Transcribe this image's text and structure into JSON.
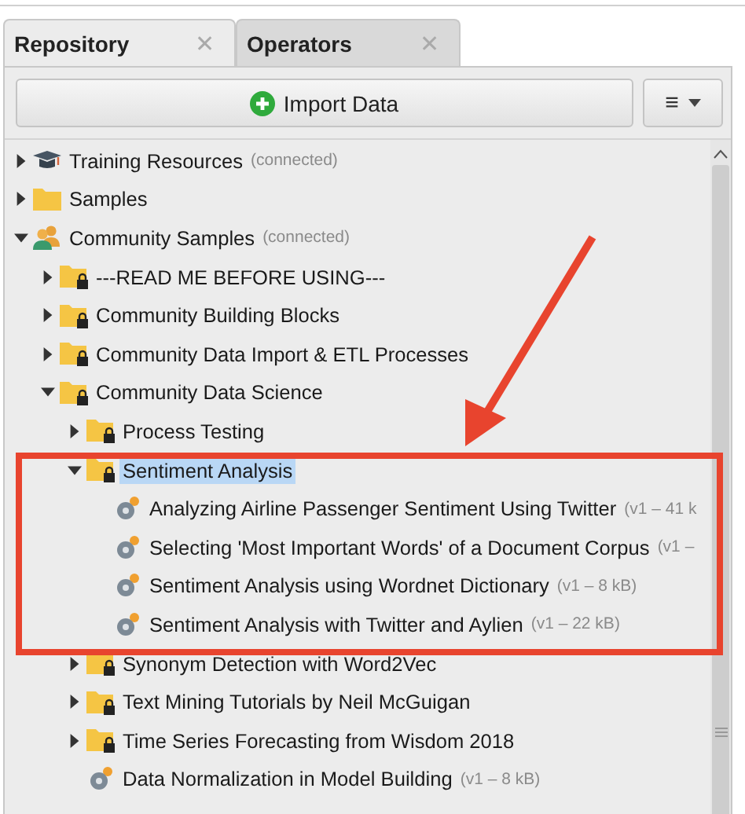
{
  "tabs": [
    {
      "label": "Repository",
      "selected": true,
      "close": "✕"
    },
    {
      "label": "Operators",
      "selected": false,
      "close": "✕"
    }
  ],
  "toolbar": {
    "import_button": "Import Data",
    "menu_button": "≡"
  },
  "tree": [
    {
      "label": "Training Resources",
      "note": "(connected)",
      "kind": "repository",
      "expanded": false,
      "selected": false
    },
    {
      "label": "Samples",
      "kind": "folder",
      "expanded": false,
      "selected": false
    },
    {
      "label": "Community Samples",
      "note": "(connected)",
      "kind": "people",
      "expanded": true,
      "selected": false,
      "children": [
        {
          "label": "---READ ME BEFORE USING---",
          "kind": "locked-folder",
          "expanded": false,
          "selected": false
        },
        {
          "label": "Community Building Blocks",
          "kind": "locked-folder",
          "expanded": false,
          "selected": false
        },
        {
          "label": "Community Data Import & ETL Processes",
          "kind": "locked-folder",
          "expanded": false,
          "selected": false
        },
        {
          "label": "Community Data Science",
          "kind": "locked-folder",
          "expanded": true,
          "selected": false,
          "children": [
            {
              "label": "Process Testing",
              "kind": "locked-folder",
              "expanded": false,
              "selected": false
            },
            {
              "label": "Sentiment Analysis",
              "kind": "locked-folder",
              "expanded": true,
              "selected": true,
              "children": [
                {
                  "label": "Analyzing Airline Passenger Sentiment Using Twitter",
                  "note": "(v1 – 41 k",
                  "kind": "process",
                  "selected": false
                },
                {
                  "label": "Selecting 'Most Important Words' of a Document Corpus",
                  "note": "(v1 –",
                  "kind": "process",
                  "selected": false
                },
                {
                  "label": "Sentiment Analysis using Wordnet Dictionary",
                  "note": "(v1 – 8 kB)",
                  "kind": "process",
                  "selected": false
                },
                {
                  "label": "Sentiment Analysis with Twitter and Aylien",
                  "note": "(v1 – 22 kB)",
                  "kind": "process",
                  "selected": false
                }
              ]
            },
            {
              "label": "Synonym Detection with Word2Vec",
              "kind": "locked-folder",
              "expanded": false,
              "selected": false
            },
            {
              "label": "Text Mining Tutorials by Neil McGuigan",
              "kind": "locked-folder",
              "expanded": false,
              "selected": false
            },
            {
              "label": "Time Series Forecasting from Wisdom 2018",
              "kind": "locked-folder",
              "expanded": false,
              "selected": false
            },
            {
              "label": "Data Normalization in Model Building",
              "note": "(v1 – 8 kB)",
              "kind": "process",
              "selected": false
            }
          ]
        }
      ]
    }
  ]
}
